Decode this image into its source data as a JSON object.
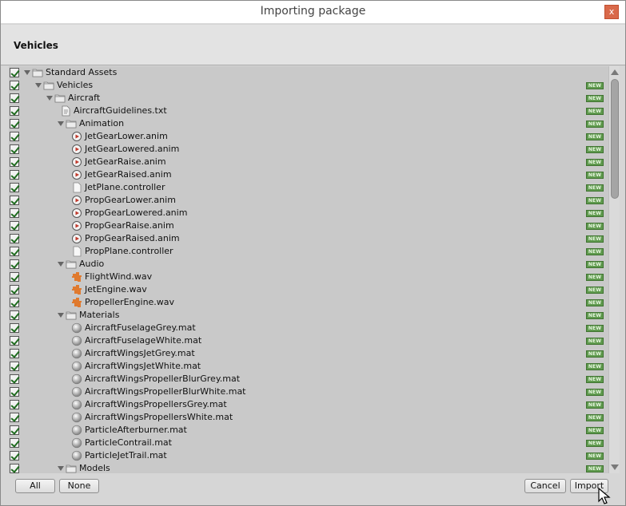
{
  "window": {
    "title": "Importing package",
    "close_label": "x"
  },
  "header": {
    "title": "Vehicles"
  },
  "tree": {
    "badge_label": "NEW",
    "items": [
      {
        "label": "Standard Assets",
        "type": "folder",
        "depth": 0,
        "badge": false
      },
      {
        "label": "Vehicles",
        "type": "folder",
        "depth": 1,
        "badge": true
      },
      {
        "label": "Aircraft",
        "type": "folder",
        "depth": 2,
        "badge": true
      },
      {
        "label": "AircraftGuidelines.txt",
        "type": "text",
        "depth": 3,
        "badge": true
      },
      {
        "label": "Animation",
        "type": "folder",
        "depth": 3,
        "badge": true
      },
      {
        "label": "JetGearLower.anim",
        "type": "anim",
        "depth": 4,
        "badge": true
      },
      {
        "label": "JetGearLowered.anim",
        "type": "anim",
        "depth": 4,
        "badge": true
      },
      {
        "label": "JetGearRaise.anim",
        "type": "anim",
        "depth": 4,
        "badge": true
      },
      {
        "label": "JetGearRaised.anim",
        "type": "anim",
        "depth": 4,
        "badge": true
      },
      {
        "label": "JetPlane.controller",
        "type": "doc",
        "depth": 4,
        "badge": true
      },
      {
        "label": "PropGearLower.anim",
        "type": "anim",
        "depth": 4,
        "badge": true
      },
      {
        "label": "PropGearLowered.anim",
        "type": "anim",
        "depth": 4,
        "badge": true
      },
      {
        "label": "PropGearRaise.anim",
        "type": "anim",
        "depth": 4,
        "badge": true
      },
      {
        "label": "PropGearRaised.anim",
        "type": "anim",
        "depth": 4,
        "badge": true
      },
      {
        "label": "PropPlane.controller",
        "type": "doc",
        "depth": 4,
        "badge": true
      },
      {
        "label": "Audio",
        "type": "folder",
        "depth": 3,
        "badge": true
      },
      {
        "label": "FlightWind.wav",
        "type": "audio",
        "depth": 4,
        "badge": true
      },
      {
        "label": "JetEngine.wav",
        "type": "audio",
        "depth": 4,
        "badge": true
      },
      {
        "label": "PropellerEngine.wav",
        "type": "audio",
        "depth": 4,
        "badge": true
      },
      {
        "label": "Materials",
        "type": "folder",
        "depth": 3,
        "badge": true
      },
      {
        "label": "AircraftFuselageGrey.mat",
        "type": "material",
        "depth": 4,
        "badge": true
      },
      {
        "label": "AircraftFuselageWhite.mat",
        "type": "material",
        "depth": 4,
        "badge": true
      },
      {
        "label": "AircraftWingsJetGrey.mat",
        "type": "material",
        "depth": 4,
        "badge": true
      },
      {
        "label": "AircraftWingsJetWhite.mat",
        "type": "material",
        "depth": 4,
        "badge": true
      },
      {
        "label": "AircraftWingsPropellerBlurGrey.mat",
        "type": "material",
        "depth": 4,
        "badge": true
      },
      {
        "label": "AircraftWingsPropellerBlurWhite.mat",
        "type": "material",
        "depth": 4,
        "badge": true
      },
      {
        "label": "AircraftWingsPropellersGrey.mat",
        "type": "material",
        "depth": 4,
        "badge": true
      },
      {
        "label": "AircraftWingsPropellersWhite.mat",
        "type": "material",
        "depth": 4,
        "badge": true
      },
      {
        "label": "ParticleAfterburner.mat",
        "type": "material",
        "depth": 4,
        "badge": true
      },
      {
        "label": "ParticleContrail.mat",
        "type": "material",
        "depth": 4,
        "badge": true
      },
      {
        "label": "ParticleJetTrail.mat",
        "type": "material",
        "depth": 4,
        "badge": true
      },
      {
        "label": "Models",
        "type": "folder",
        "depth": 3,
        "badge": true
      }
    ]
  },
  "footer": {
    "all_label": "All",
    "none_label": "None",
    "cancel_label": "Cancel",
    "import_label": "Import"
  },
  "colors": {
    "badge_bg": "#5f9a4e",
    "close_bg": "#d9694a",
    "audio_icon": "#e07a2e"
  }
}
